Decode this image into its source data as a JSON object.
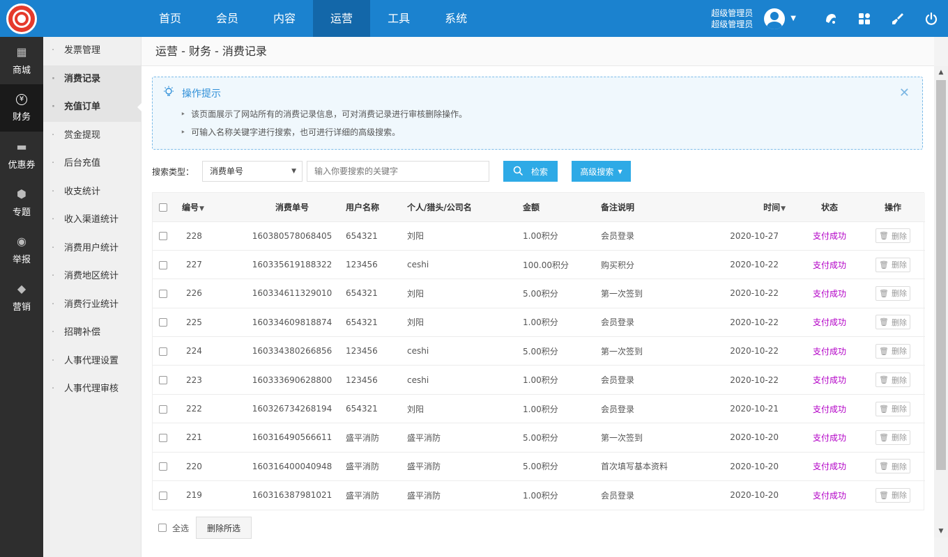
{
  "topnav": {
    "items": [
      {
        "label": "首页"
      },
      {
        "label": "会员"
      },
      {
        "label": "内容"
      },
      {
        "label": "运营"
      },
      {
        "label": "工具"
      },
      {
        "label": "系统"
      }
    ],
    "active_index": 3
  },
  "user": {
    "role": "超级管理员",
    "name": "超级管理员"
  },
  "leftbar": {
    "items": [
      {
        "label": "商城",
        "icon": "gift-icon"
      },
      {
        "label": "财务",
        "icon": "yen-icon"
      },
      {
        "label": "优惠券",
        "icon": "ticket-icon"
      },
      {
        "label": "专题",
        "icon": "star-shield-icon"
      },
      {
        "label": "举报",
        "icon": "alert-icon"
      },
      {
        "label": "营销",
        "icon": "tag-icon"
      }
    ],
    "active_index": 1
  },
  "subnav": {
    "items": [
      {
        "label": "发票管理"
      },
      {
        "label": "消费记录"
      },
      {
        "label": "充值订单"
      },
      {
        "label": "赏金提现"
      },
      {
        "label": "后台充值"
      },
      {
        "label": "收支统计"
      },
      {
        "label": "收入渠道统计"
      },
      {
        "label": "消费用户统计"
      },
      {
        "label": "消费地区统计"
      },
      {
        "label": "消费行业统计"
      },
      {
        "label": "招聘补偿"
      },
      {
        "label": "人事代理设置"
      },
      {
        "label": "人事代理审核"
      }
    ]
  },
  "breadcrumb": "运营 - 财务 - 消费记录",
  "tips": {
    "title": "操作提示",
    "lines": [
      "该页面展示了网站所有的消费记录信息，可对消费记录进行审核删除操作。",
      "可输入名称关键字进行搜索，也可进行详细的高级搜索。"
    ]
  },
  "search": {
    "type_label": "搜索类型：",
    "type_value": "消费单号",
    "placeholder": "输入你要搜索的关键字",
    "search_button": "检索",
    "advanced_button": "高级搜索"
  },
  "table": {
    "headers": [
      "编号",
      "消费单号",
      "用户名称",
      "个人/猎头/公司名",
      "金额",
      "备注说明",
      "时间",
      "状态",
      "操作"
    ],
    "delete_label": "删除",
    "rows": [
      {
        "id": "228",
        "order": "160380578068405",
        "user": "654321",
        "name": "刘阳",
        "amount": "1.00积分",
        "note": "会员登录",
        "time": "2020-10-27",
        "status": "支付成功"
      },
      {
        "id": "227",
        "order": "160335619188322",
        "user": "123456",
        "name": "ceshi",
        "amount": "100.00积分",
        "note": "购买积分",
        "time": "2020-10-22",
        "status": "支付成功"
      },
      {
        "id": "226",
        "order": "160334611329010",
        "user": "654321",
        "name": "刘阳",
        "amount": "5.00积分",
        "note": "第一次签到",
        "time": "2020-10-22",
        "status": "支付成功"
      },
      {
        "id": "225",
        "order": "160334609818874",
        "user": "654321",
        "name": "刘阳",
        "amount": "1.00积分",
        "note": "会员登录",
        "time": "2020-10-22",
        "status": "支付成功"
      },
      {
        "id": "224",
        "order": "160334380266856",
        "user": "123456",
        "name": "ceshi",
        "amount": "5.00积分",
        "note": "第一次签到",
        "time": "2020-10-22",
        "status": "支付成功"
      },
      {
        "id": "223",
        "order": "160333690628800",
        "user": "123456",
        "name": "ceshi",
        "amount": "1.00积分",
        "note": "会员登录",
        "time": "2020-10-22",
        "status": "支付成功"
      },
      {
        "id": "222",
        "order": "160326734268194",
        "user": "654321",
        "name": "刘阳",
        "amount": "1.00积分",
        "note": "会员登录",
        "time": "2020-10-21",
        "status": "支付成功"
      },
      {
        "id": "221",
        "order": "160316490566611",
        "user": "盛平消防",
        "name": "盛平消防",
        "amount": "5.00积分",
        "note": "第一次签到",
        "time": "2020-10-20",
        "status": "支付成功"
      },
      {
        "id": "220",
        "order": "160316400040948",
        "user": "盛平消防",
        "name": "盛平消防",
        "amount": "5.00积分",
        "note": "首次填写基本资料",
        "time": "2020-10-20",
        "status": "支付成功"
      },
      {
        "id": "219",
        "order": "160316387981021",
        "user": "盛平消防",
        "name": "盛平消防",
        "amount": "1.00积分",
        "note": "会员登录",
        "time": "2020-10-20",
        "status": "支付成功"
      }
    ]
  },
  "footer": {
    "select_all": "全选",
    "delete_selected": "删除所选"
  },
  "colors": {
    "topbar": "#1b82cf",
    "active_nav": "#1367a9",
    "button": "#2eaae6",
    "status": "#b300c7"
  }
}
